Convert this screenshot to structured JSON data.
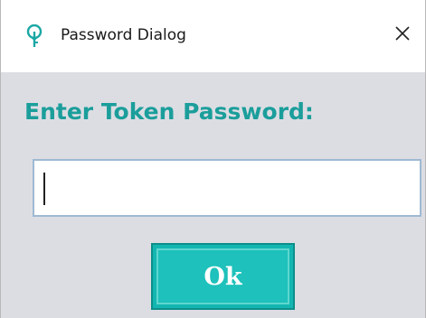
{
  "window": {
    "title": "Password Dialog",
    "icon": "key-lock-icon",
    "close_icon": "close-icon"
  },
  "prompt": {
    "label": "Enter Token Password:"
  },
  "password_field": {
    "value": "",
    "placeholder": ""
  },
  "actions": {
    "ok_label": "Ok"
  },
  "colors": {
    "accent": "#1b9e9b",
    "button": "#13b6b0",
    "dialog_bg": "#dcdde3"
  }
}
